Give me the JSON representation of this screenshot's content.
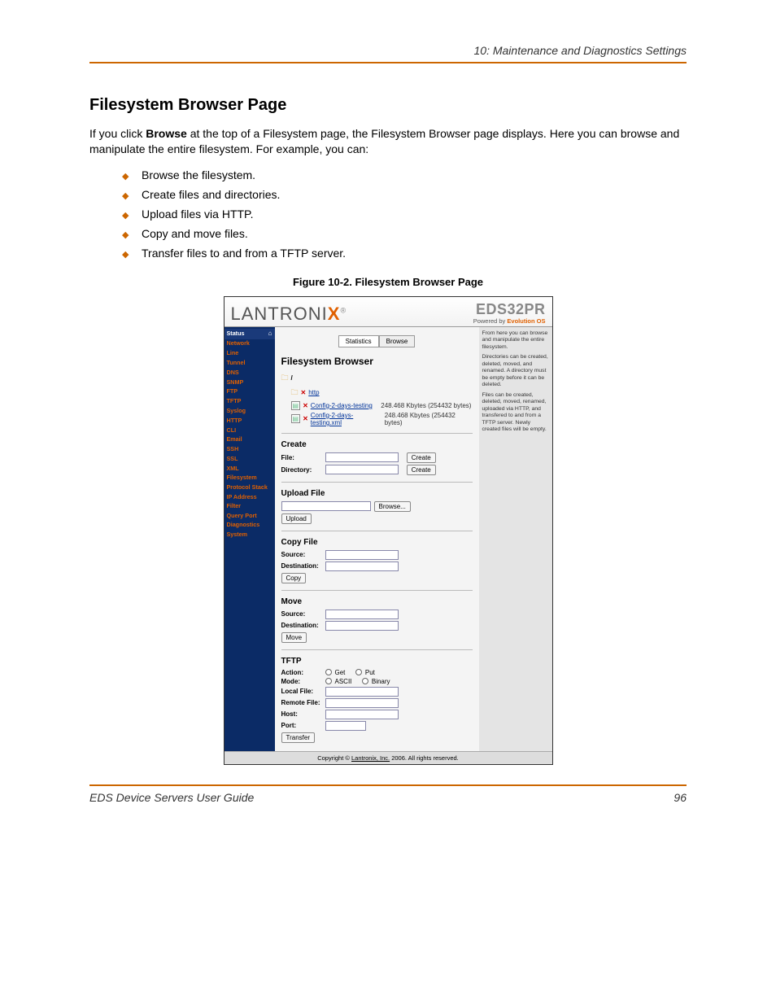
{
  "running_head": "10: Maintenance and Diagnostics Settings",
  "section_title": "Filesystem Browser Page",
  "intro_pre": "If you click ",
  "intro_bold": "Browse",
  "intro_post": " at the top of a Filesystem page, the Filesystem Browser page displays. Here you can browse and manipulate the entire filesystem. For example, you can:",
  "bullets": [
    "Browse the filesystem.",
    "Create files and directories.",
    "Upload files via HTTP.",
    "Copy and move files.",
    "Transfer files to and from a TFTP server."
  ],
  "figure_caption": "Figure 10-2. Filesystem Browser Page",
  "brand_prefix": "LANTRONI",
  "brand_x": "X",
  "brand_reg": "®",
  "model_name": "EDS32PR",
  "powered_pre": "Powered by ",
  "powered_evo": "Evolution OS",
  "nav_items": [
    "Status",
    "Network",
    "Line",
    "Tunnel",
    "DNS",
    "SNMP",
    "FTP",
    "TFTP",
    "Syslog",
    "HTTP",
    "CLI",
    "Email",
    "SSH",
    "SSL",
    "XML",
    "Filesystem",
    "Protocol Stack",
    "IP Address Filter",
    "Query Port",
    "Diagnostics",
    "System"
  ],
  "tabs": {
    "stats": "Statistics",
    "browse": "Browse"
  },
  "fs_heading": "Filesystem Browser",
  "fs_root": "/",
  "fs": {
    "dir": {
      "name": "http"
    },
    "file1": {
      "name": "Config-2-days-testing",
      "size": "248.468 Kbytes (254432 bytes)"
    },
    "file2": {
      "name": "Config-2-days-testing.xml",
      "size": "248.468 Kbytes (254432 bytes)"
    }
  },
  "create": {
    "title": "Create",
    "file_lbl": "File:",
    "dir_lbl": "Directory:",
    "btn": "Create"
  },
  "upload": {
    "title": "Upload File",
    "browse_btn": "Browse...",
    "upload_btn": "Upload"
  },
  "copy": {
    "title": "Copy File",
    "src_lbl": "Source:",
    "dst_lbl": "Destination:",
    "btn": "Copy"
  },
  "move": {
    "title": "Move",
    "src_lbl": "Source:",
    "dst_lbl": "Destination:",
    "btn": "Move"
  },
  "tftp": {
    "title": "TFTP",
    "action_lbl": "Action:",
    "get": "Get",
    "put": "Put",
    "mode_lbl": "Mode:",
    "ascii": "ASCII",
    "bin": "Binary",
    "local_lbl": "Local File:",
    "remote_lbl": "Remote File:",
    "host_lbl": "Host:",
    "port_lbl": "Port:",
    "btn": "Transfer"
  },
  "help": {
    "p1": "From here you can browse and manipulate the entire filesystem.",
    "p2": "Directories can be created, deleted, moved, and renamed. A directory must be empty before it can be deleted.",
    "p3": "Files can be created, deleted, moved, renamed, uploaded via HTTP, and transfered to and from a TFTP server. Newly created files will be empty."
  },
  "shot_footer_pre": "Copyright © ",
  "shot_footer_link": "Lantronix, Inc.",
  "shot_footer_post": " 2006. All rights reserved.",
  "footer_guide": "EDS Device Servers User Guide",
  "footer_page": "96"
}
